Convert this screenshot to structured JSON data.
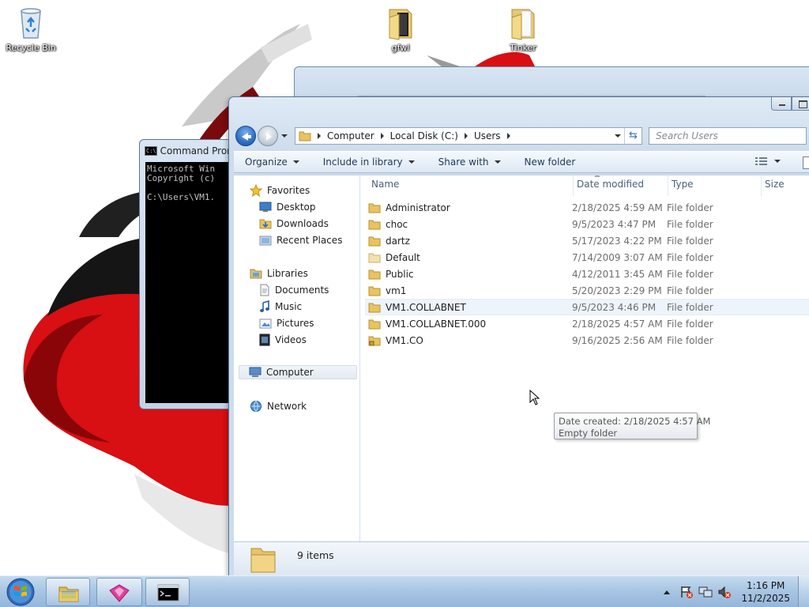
{
  "desktop": {
    "icons": [
      {
        "label": "Recycle Bin",
        "icon": "recycle-bin-icon"
      },
      {
        "label": "gfwl",
        "icon": "folder-icon"
      },
      {
        "label": "Tinker",
        "icon": "folder-icon"
      }
    ]
  },
  "cmd_window": {
    "title": "Command Prom",
    "lines": [
      "Microsoft Win",
      "Copyright (c)",
      "",
      "C:\\Users\\VM1."
    ]
  },
  "explorer": {
    "breadcrumb": [
      "Computer",
      "Local Disk (C:)",
      "Users"
    ],
    "search_placeholder": "Search Users",
    "toolbar": {
      "organize": "Organize",
      "include_in_library": "Include in library",
      "share_with": "Share with",
      "new_folder": "New folder"
    },
    "nav": {
      "favorites": "Favorites",
      "desktop": "Desktop",
      "downloads": "Downloads",
      "recent_places": "Recent Places",
      "libraries": "Libraries",
      "documents": "Documents",
      "music": "Music",
      "pictures": "Pictures",
      "videos": "Videos",
      "computer": "Computer",
      "network": "Network"
    },
    "columns": {
      "name": "Name",
      "date": "Date modified",
      "type": "Type",
      "size": "Size"
    },
    "rows": [
      {
        "name": "Administrator",
        "date": "2/18/2025 4:59 AM",
        "type": "File folder"
      },
      {
        "name": "choc",
        "date": "9/5/2023 4:47 PM",
        "type": "File folder"
      },
      {
        "name": "dartz",
        "date": "5/17/2023 4:22 PM",
        "type": "File folder"
      },
      {
        "name": "Default",
        "date": "7/14/2009 3:07 AM",
        "type": "File folder"
      },
      {
        "name": "Public",
        "date": "4/12/2011 3:45 AM",
        "type": "File folder"
      },
      {
        "name": "vm1",
        "date": "5/20/2023 2:29 PM",
        "type": "File folder"
      },
      {
        "name": "VM1.COLLABNET",
        "date": "9/5/2023 4:46 PM",
        "type": "File folder"
      },
      {
        "name": "VM1.COLLABNET.000",
        "date": "2/18/2025 4:57 AM",
        "type": "File folder"
      },
      {
        "name": "VM1.CO",
        "date": "9/16/2025 2:56 AM",
        "type": "File folder"
      }
    ],
    "tooltip": {
      "line1": "Date created: 2/18/2025 4:57 AM",
      "line2": "Empty folder"
    },
    "status": {
      "count": "9 items"
    }
  },
  "taskbar": {
    "clock_time": "1:16 PM",
    "clock_date": "11/2/2025",
    "apps": [
      "windows-explorer-icon",
      "app-icon",
      "command-prompt-icon"
    ]
  },
  "colors": {
    "wallpaper_red": "#d80f13",
    "wallpaper_black": "#111111",
    "selection_blue": "#3a6bb5"
  }
}
